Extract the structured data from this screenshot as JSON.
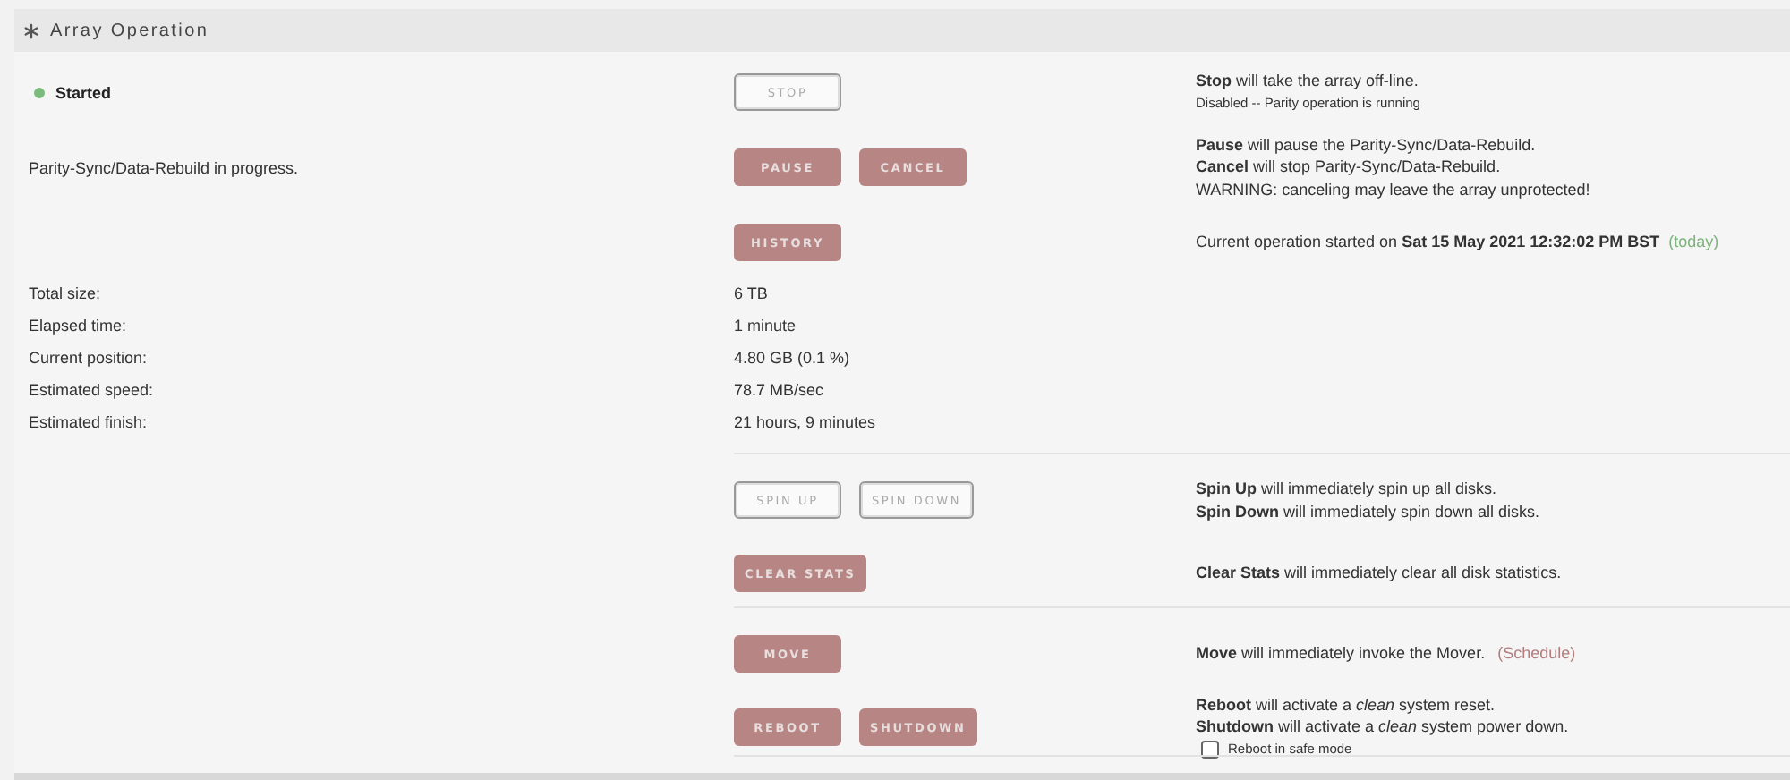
{
  "panel": {
    "title": "Array Operation"
  },
  "groups": [
    {
      "rows": [
        {
          "kind": "action",
          "status": {
            "label": "Started",
            "color": "#7dbb7d"
          },
          "buttons": [
            {
              "label": "STOP",
              "disabled": true
            }
          ],
          "notes": [
            {
              "kind": "text",
              "text": "**Stop** will take the array off-line."
            },
            {
              "kind": "small",
              "text": "Disabled -- Parity operation is running"
            }
          ]
        },
        {
          "kind": "action",
          "label": "Parity-Sync/Data-Rebuild in progress.",
          "buttons": [
            {
              "label": "PAUSE",
              "disabled": false
            },
            {
              "label": "CANCEL",
              "disabled": false
            }
          ],
          "notes": [
            {
              "kind": "text",
              "text": "**Pause** will pause the Parity-Sync/Data-Rebuild."
            },
            {
              "kind": "text",
              "text": "**Cancel** will stop Parity-Sync/Data-Rebuild."
            },
            {
              "kind": "text",
              "text": "WARNING: canceling may leave the array unprotected!"
            }
          ]
        },
        {
          "kind": "action",
          "buttons": [
            {
              "label": "HISTORY",
              "disabled": false
            }
          ],
          "notes": [
            {
              "kind": "text",
              "text": "Current operation started on **Sat 15 May 2021 12:32:02 PM BST**",
              "tag": {
                "kind": "today",
                "text": "(today)"
              }
            }
          ]
        },
        {
          "kind": "stat",
          "label": "Total size:",
          "value": "6 TB"
        },
        {
          "kind": "stat",
          "label": "Elapsed time:",
          "value": "1 minute"
        },
        {
          "kind": "stat",
          "label": "Current position:",
          "value": "4.80 GB (0.1 %)"
        },
        {
          "kind": "stat",
          "label": "Estimated speed:",
          "value": "78.7 MB/sec"
        },
        {
          "kind": "stat",
          "label": "Estimated finish:",
          "value": "21 hours, 9 minutes"
        }
      ]
    },
    {
      "rows": [
        {
          "kind": "action",
          "buttons": [
            {
              "label": "SPIN UP",
              "disabled": true
            },
            {
              "label": "SPIN DOWN",
              "disabled": true
            }
          ],
          "notes": [
            {
              "kind": "text",
              "text": "**Spin Up** will immediately spin up all disks."
            },
            {
              "kind": "text",
              "text": "**Spin Down** will immediately spin down all disks."
            }
          ]
        },
        {
          "kind": "action",
          "buttons": [
            {
              "label": "CLEAR STATS",
              "disabled": false
            }
          ],
          "notes": [
            {
              "kind": "text",
              "text": "**Clear Stats** will immediately clear all disk statistics."
            }
          ]
        }
      ]
    },
    {
      "rows": [
        {
          "kind": "action",
          "buttons": [
            {
              "label": "MOVE",
              "disabled": false
            }
          ],
          "notes": [
            {
              "kind": "text",
              "text": "**Move** will immediately invoke the Mover.",
              "tag": {
                "kind": "link",
                "text": "(Schedule)"
              }
            }
          ]
        },
        {
          "kind": "action",
          "buttons": [
            {
              "label": "REBOOT",
              "disabled": false
            },
            {
              "label": "SHUTDOWN",
              "disabled": false
            }
          ],
          "notes": [
            {
              "kind": "text",
              "text": "**Reboot** will activate a *clean* system reset."
            },
            {
              "kind": "text",
              "text": "**Shutdown** will activate a *clean* system power down."
            },
            {
              "kind": "checkbox",
              "text": "Reboot in safe mode",
              "checked": false
            }
          ]
        }
      ]
    }
  ]
}
